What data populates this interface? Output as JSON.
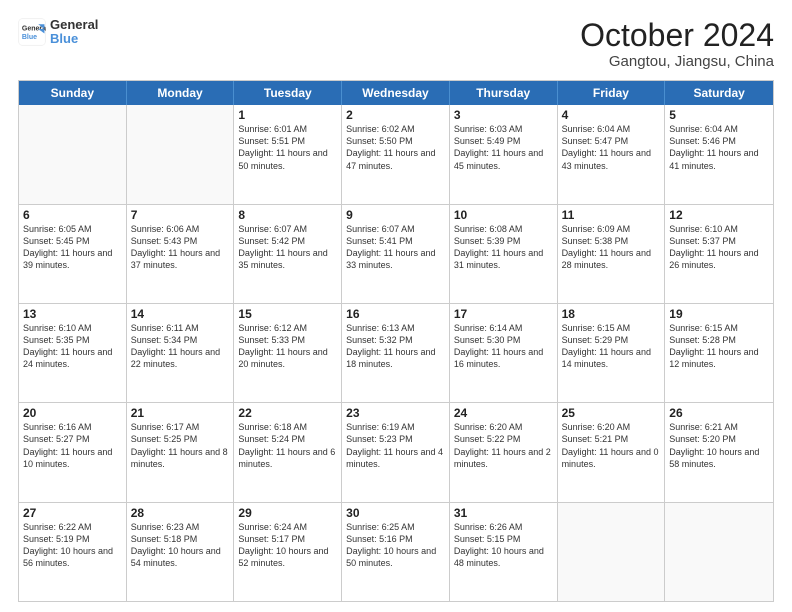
{
  "logo": {
    "line1": "General",
    "line2": "Blue"
  },
  "title": "October 2024",
  "location": "Gangtou, Jiangsu, China",
  "days_of_week": [
    "Sunday",
    "Monday",
    "Tuesday",
    "Wednesday",
    "Thursday",
    "Friday",
    "Saturday"
  ],
  "weeks": [
    [
      {
        "day": "",
        "info": ""
      },
      {
        "day": "",
        "info": ""
      },
      {
        "day": "1",
        "info": "Sunrise: 6:01 AM\nSunset: 5:51 PM\nDaylight: 11 hours and 50 minutes."
      },
      {
        "day": "2",
        "info": "Sunrise: 6:02 AM\nSunset: 5:50 PM\nDaylight: 11 hours and 47 minutes."
      },
      {
        "day": "3",
        "info": "Sunrise: 6:03 AM\nSunset: 5:49 PM\nDaylight: 11 hours and 45 minutes."
      },
      {
        "day": "4",
        "info": "Sunrise: 6:04 AM\nSunset: 5:47 PM\nDaylight: 11 hours and 43 minutes."
      },
      {
        "day": "5",
        "info": "Sunrise: 6:04 AM\nSunset: 5:46 PM\nDaylight: 11 hours and 41 minutes."
      }
    ],
    [
      {
        "day": "6",
        "info": "Sunrise: 6:05 AM\nSunset: 5:45 PM\nDaylight: 11 hours and 39 minutes."
      },
      {
        "day": "7",
        "info": "Sunrise: 6:06 AM\nSunset: 5:43 PM\nDaylight: 11 hours and 37 minutes."
      },
      {
        "day": "8",
        "info": "Sunrise: 6:07 AM\nSunset: 5:42 PM\nDaylight: 11 hours and 35 minutes."
      },
      {
        "day": "9",
        "info": "Sunrise: 6:07 AM\nSunset: 5:41 PM\nDaylight: 11 hours and 33 minutes."
      },
      {
        "day": "10",
        "info": "Sunrise: 6:08 AM\nSunset: 5:39 PM\nDaylight: 11 hours and 31 minutes."
      },
      {
        "day": "11",
        "info": "Sunrise: 6:09 AM\nSunset: 5:38 PM\nDaylight: 11 hours and 28 minutes."
      },
      {
        "day": "12",
        "info": "Sunrise: 6:10 AM\nSunset: 5:37 PM\nDaylight: 11 hours and 26 minutes."
      }
    ],
    [
      {
        "day": "13",
        "info": "Sunrise: 6:10 AM\nSunset: 5:35 PM\nDaylight: 11 hours and 24 minutes."
      },
      {
        "day": "14",
        "info": "Sunrise: 6:11 AM\nSunset: 5:34 PM\nDaylight: 11 hours and 22 minutes."
      },
      {
        "day": "15",
        "info": "Sunrise: 6:12 AM\nSunset: 5:33 PM\nDaylight: 11 hours and 20 minutes."
      },
      {
        "day": "16",
        "info": "Sunrise: 6:13 AM\nSunset: 5:32 PM\nDaylight: 11 hours and 18 minutes."
      },
      {
        "day": "17",
        "info": "Sunrise: 6:14 AM\nSunset: 5:30 PM\nDaylight: 11 hours and 16 minutes."
      },
      {
        "day": "18",
        "info": "Sunrise: 6:15 AM\nSunset: 5:29 PM\nDaylight: 11 hours and 14 minutes."
      },
      {
        "day": "19",
        "info": "Sunrise: 6:15 AM\nSunset: 5:28 PM\nDaylight: 11 hours and 12 minutes."
      }
    ],
    [
      {
        "day": "20",
        "info": "Sunrise: 6:16 AM\nSunset: 5:27 PM\nDaylight: 11 hours and 10 minutes."
      },
      {
        "day": "21",
        "info": "Sunrise: 6:17 AM\nSunset: 5:25 PM\nDaylight: 11 hours and 8 minutes."
      },
      {
        "day": "22",
        "info": "Sunrise: 6:18 AM\nSunset: 5:24 PM\nDaylight: 11 hours and 6 minutes."
      },
      {
        "day": "23",
        "info": "Sunrise: 6:19 AM\nSunset: 5:23 PM\nDaylight: 11 hours and 4 minutes."
      },
      {
        "day": "24",
        "info": "Sunrise: 6:20 AM\nSunset: 5:22 PM\nDaylight: 11 hours and 2 minutes."
      },
      {
        "day": "25",
        "info": "Sunrise: 6:20 AM\nSunset: 5:21 PM\nDaylight: 11 hours and 0 minutes."
      },
      {
        "day": "26",
        "info": "Sunrise: 6:21 AM\nSunset: 5:20 PM\nDaylight: 10 hours and 58 minutes."
      }
    ],
    [
      {
        "day": "27",
        "info": "Sunrise: 6:22 AM\nSunset: 5:19 PM\nDaylight: 10 hours and 56 minutes."
      },
      {
        "day": "28",
        "info": "Sunrise: 6:23 AM\nSunset: 5:18 PM\nDaylight: 10 hours and 54 minutes."
      },
      {
        "day": "29",
        "info": "Sunrise: 6:24 AM\nSunset: 5:17 PM\nDaylight: 10 hours and 52 minutes."
      },
      {
        "day": "30",
        "info": "Sunrise: 6:25 AM\nSunset: 5:16 PM\nDaylight: 10 hours and 50 minutes."
      },
      {
        "day": "31",
        "info": "Sunrise: 6:26 AM\nSunset: 5:15 PM\nDaylight: 10 hours and 48 minutes."
      },
      {
        "day": "",
        "info": ""
      },
      {
        "day": "",
        "info": ""
      }
    ]
  ]
}
